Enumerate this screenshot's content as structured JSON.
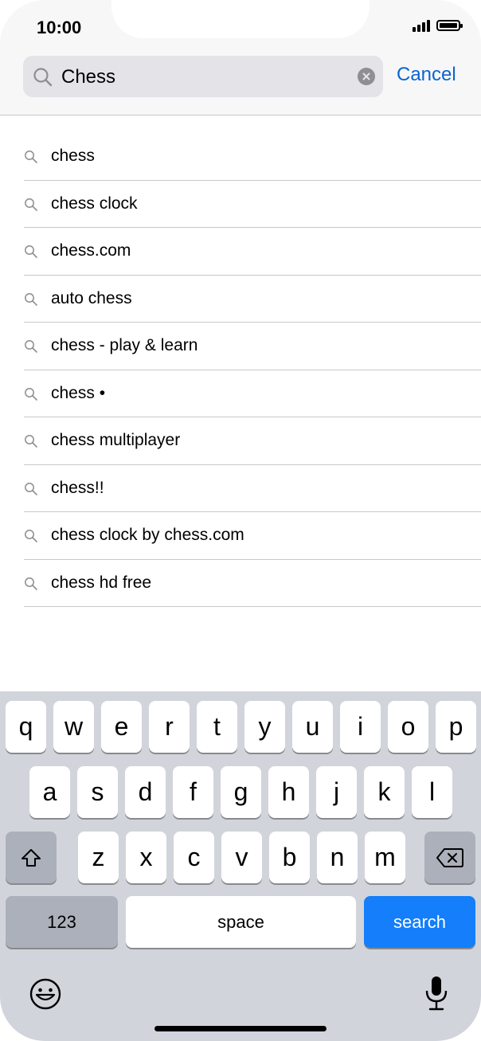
{
  "status": {
    "time": "10:00"
  },
  "search": {
    "value": "Chess",
    "cancel_label": "Cancel"
  },
  "suggestions": [
    "chess",
    "chess clock",
    "chess.com",
    "auto chess",
    "chess - play & learn",
    "chess •",
    "chess multiplayer",
    "chess!!",
    "chess clock by chess.com",
    "chess hd free"
  ],
  "keyboard": {
    "row1": [
      "q",
      "w",
      "e",
      "r",
      "t",
      "y",
      "u",
      "i",
      "o",
      "p"
    ],
    "row2": [
      "a",
      "s",
      "d",
      "f",
      "g",
      "h",
      "j",
      "k",
      "l"
    ],
    "row3": [
      "z",
      "x",
      "c",
      "v",
      "b",
      "n",
      "m"
    ],
    "numbers_label": "123",
    "space_label": "space",
    "search_label": "search"
  },
  "colors": {
    "accent": "#147efb",
    "link": "#0a64d0",
    "keyboard_bg": "#d1d4db"
  }
}
